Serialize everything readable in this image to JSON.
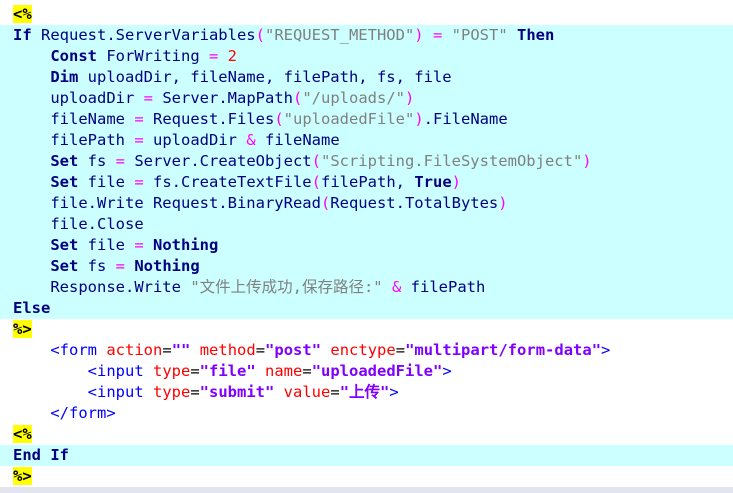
{
  "editor": {
    "lines": [
      {
        "bg": "plain",
        "tokens": [
          {
            "t": "<%",
            "c": "delim"
          }
        ]
      },
      {
        "bg": "cyan",
        "tokens": [
          {
            "t": "If",
            "c": "kw"
          },
          {
            "t": " Request.ServerVariables",
            "c": "ident"
          },
          {
            "t": "(",
            "c": "op"
          },
          {
            "t": "\"REQUEST_METHOD\"",
            "c": "str"
          },
          {
            "t": ")",
            "c": "op"
          },
          {
            "t": " ",
            "c": "ident"
          },
          {
            "t": "=",
            "c": "op"
          },
          {
            "t": " ",
            "c": "ident"
          },
          {
            "t": "\"POST\"",
            "c": "str"
          },
          {
            "t": " ",
            "c": "ident"
          },
          {
            "t": "Then",
            "c": "kw"
          }
        ]
      },
      {
        "bg": "cyan",
        "tokens": [
          {
            "t": "    ",
            "c": "ident"
          },
          {
            "t": "Const",
            "c": "kw"
          },
          {
            "t": " ForWriting ",
            "c": "ident"
          },
          {
            "t": "=",
            "c": "op"
          },
          {
            "t": " ",
            "c": "ident"
          },
          {
            "t": "2",
            "c": "num"
          }
        ]
      },
      {
        "bg": "cyan",
        "tokens": [
          {
            "t": "    ",
            "c": "ident"
          },
          {
            "t": "Dim",
            "c": "kw"
          },
          {
            "t": " uploadDir, fileName, filePath, fs, file",
            "c": "ident"
          }
        ]
      },
      {
        "bg": "cyan",
        "tokens": [
          {
            "t": "    uploadDir ",
            "c": "ident"
          },
          {
            "t": "=",
            "c": "op"
          },
          {
            "t": " Server.MapPath",
            "c": "ident"
          },
          {
            "t": "(",
            "c": "op"
          },
          {
            "t": "\"/uploads/\"",
            "c": "str"
          },
          {
            "t": ")",
            "c": "op"
          }
        ]
      },
      {
        "bg": "cyan",
        "tokens": [
          {
            "t": "    fileName ",
            "c": "ident"
          },
          {
            "t": "=",
            "c": "op"
          },
          {
            "t": " Request.Files",
            "c": "ident"
          },
          {
            "t": "(",
            "c": "op"
          },
          {
            "t": "\"uploadedFile\"",
            "c": "str"
          },
          {
            "t": ")",
            "c": "op"
          },
          {
            "t": ".FileName",
            "c": "ident"
          }
        ]
      },
      {
        "bg": "cyan",
        "tokens": [
          {
            "t": "    filePath ",
            "c": "ident"
          },
          {
            "t": "=",
            "c": "op"
          },
          {
            "t": " uploadDir ",
            "c": "ident"
          },
          {
            "t": "&",
            "c": "op"
          },
          {
            "t": " fileName",
            "c": "ident"
          }
        ]
      },
      {
        "bg": "cyan",
        "tokens": [
          {
            "t": "    ",
            "c": "ident"
          },
          {
            "t": "Set",
            "c": "kw"
          },
          {
            "t": " fs ",
            "c": "ident"
          },
          {
            "t": "=",
            "c": "op"
          },
          {
            "t": " Server.CreateObject",
            "c": "ident"
          },
          {
            "t": "(",
            "c": "op"
          },
          {
            "t": "\"Scripting.FileSystemObject\"",
            "c": "str"
          },
          {
            "t": ")",
            "c": "op"
          }
        ]
      },
      {
        "bg": "cyan",
        "tokens": [
          {
            "t": "    ",
            "c": "ident"
          },
          {
            "t": "Set",
            "c": "kw"
          },
          {
            "t": " file ",
            "c": "ident"
          },
          {
            "t": "=",
            "c": "op"
          },
          {
            "t": " fs.CreateTextFile",
            "c": "ident"
          },
          {
            "t": "(",
            "c": "op"
          },
          {
            "t": "filePath, ",
            "c": "ident"
          },
          {
            "t": "True",
            "c": "kw"
          },
          {
            "t": ")",
            "c": "op"
          }
        ]
      },
      {
        "bg": "cyan",
        "tokens": [
          {
            "t": "    file.Write Request.BinaryRead",
            "c": "ident"
          },
          {
            "t": "(",
            "c": "op"
          },
          {
            "t": "Request.TotalBytes",
            "c": "ident"
          },
          {
            "t": ")",
            "c": "op"
          }
        ]
      },
      {
        "bg": "cyan",
        "tokens": [
          {
            "t": "    file.Close",
            "c": "ident"
          }
        ]
      },
      {
        "bg": "cyan",
        "tokens": [
          {
            "t": "    ",
            "c": "ident"
          },
          {
            "t": "Set",
            "c": "kw"
          },
          {
            "t": " file ",
            "c": "ident"
          },
          {
            "t": "=",
            "c": "op"
          },
          {
            "t": " ",
            "c": "ident"
          },
          {
            "t": "Nothing",
            "c": "kw"
          }
        ]
      },
      {
        "bg": "cyan",
        "tokens": [
          {
            "t": "    ",
            "c": "ident"
          },
          {
            "t": "Set",
            "c": "kw"
          },
          {
            "t": " fs ",
            "c": "ident"
          },
          {
            "t": "=",
            "c": "op"
          },
          {
            "t": " ",
            "c": "ident"
          },
          {
            "t": "Nothing",
            "c": "kw"
          }
        ]
      },
      {
        "bg": "cyan",
        "tokens": [
          {
            "t": "    Response.Write ",
            "c": "ident"
          },
          {
            "t": "\"文件上传成功,保存路径:\"",
            "c": "str"
          },
          {
            "t": " ",
            "c": "ident"
          },
          {
            "t": "&",
            "c": "op"
          },
          {
            "t": " filePath",
            "c": "ident"
          }
        ]
      },
      {
        "bg": "cyan",
        "tokens": [
          {
            "t": "Else",
            "c": "kw"
          }
        ]
      },
      {
        "bg": "plain",
        "tokens": [
          {
            "t": "%>",
            "c": "delim"
          }
        ]
      },
      {
        "bg": "plain",
        "tokens": [
          {
            "t": "    ",
            "c": "ident"
          },
          {
            "t": "<form",
            "c": "tag"
          },
          {
            "t": " ",
            "c": "ident"
          },
          {
            "t": "action",
            "c": "attr"
          },
          {
            "t": "=",
            "c": "eq"
          },
          {
            "t": "\"\"",
            "c": "aval"
          },
          {
            "t": " ",
            "c": "ident"
          },
          {
            "t": "method",
            "c": "attr"
          },
          {
            "t": "=",
            "c": "eq"
          },
          {
            "t": "\"post\"",
            "c": "aval"
          },
          {
            "t": " ",
            "c": "ident"
          },
          {
            "t": "enctype",
            "c": "attr"
          },
          {
            "t": "=",
            "c": "eq"
          },
          {
            "t": "\"multipart/form-data\"",
            "c": "aval"
          },
          {
            "t": ">",
            "c": "tag"
          }
        ]
      },
      {
        "bg": "plain",
        "tokens": [
          {
            "t": "        ",
            "c": "ident"
          },
          {
            "t": "<input",
            "c": "tag"
          },
          {
            "t": " ",
            "c": "ident"
          },
          {
            "t": "type",
            "c": "attr"
          },
          {
            "t": "=",
            "c": "eq"
          },
          {
            "t": "\"file\"",
            "c": "aval"
          },
          {
            "t": " ",
            "c": "ident"
          },
          {
            "t": "name",
            "c": "attr"
          },
          {
            "t": "=",
            "c": "eq"
          },
          {
            "t": "\"uploadedFile\"",
            "c": "aval"
          },
          {
            "t": ">",
            "c": "tag"
          }
        ]
      },
      {
        "bg": "plain",
        "tokens": [
          {
            "t": "        ",
            "c": "ident"
          },
          {
            "t": "<input",
            "c": "tag"
          },
          {
            "t": " ",
            "c": "ident"
          },
          {
            "t": "type",
            "c": "attr"
          },
          {
            "t": "=",
            "c": "eq"
          },
          {
            "t": "\"submit\"",
            "c": "aval"
          },
          {
            "t": " ",
            "c": "ident"
          },
          {
            "t": "value",
            "c": "attr"
          },
          {
            "t": "=",
            "c": "eq"
          },
          {
            "t": "\"上传\"",
            "c": "aval"
          },
          {
            "t": ">",
            "c": "tag"
          }
        ]
      },
      {
        "bg": "plain",
        "tokens": [
          {
            "t": "    ",
            "c": "ident"
          },
          {
            "t": "</form>",
            "c": "tag"
          }
        ]
      },
      {
        "bg": "plain",
        "tokens": [
          {
            "t": "<%",
            "c": "delim"
          }
        ]
      },
      {
        "bg": "cyan",
        "tokens": [
          {
            "t": "End If",
            "c": "kw"
          }
        ]
      },
      {
        "bg": "plain",
        "tokens": [
          {
            "t": "%>",
            "c": "delim"
          }
        ]
      }
    ],
    "colors": {
      "block_highlight": "#ccffff",
      "delimiter_highlight": "#ffff00",
      "keyword": "#000080",
      "operator": "#ff00ff",
      "string": "#808080",
      "number": "#ff0000",
      "html_tag": "#0000ff",
      "html_attribute": "#ff0000",
      "html_attribute_value": "#8000ff"
    }
  }
}
